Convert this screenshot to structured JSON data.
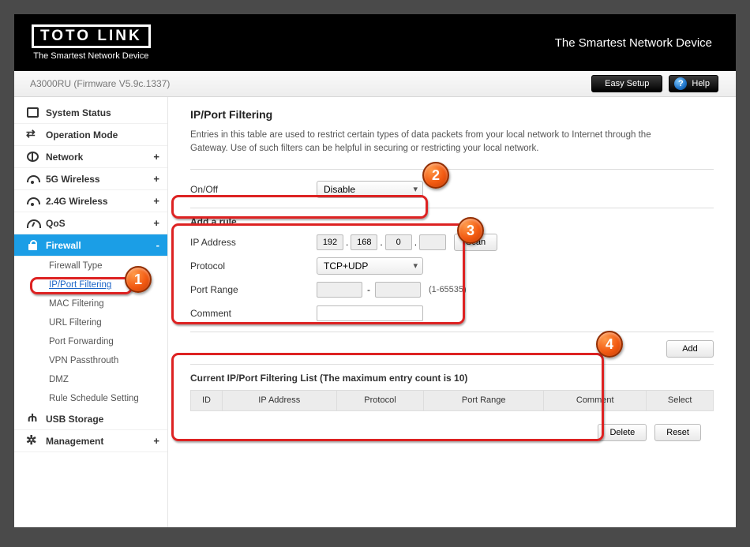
{
  "brand": {
    "logo": "TOTO LINK",
    "tagline": "The Smartest Network Device",
    "slogan": "The Smartest Network Device"
  },
  "firmware": "A3000RU (Firmware V5.9c.1337)",
  "topbuttons": {
    "easy": "Easy Setup",
    "help": "Help"
  },
  "sidebar": {
    "items": [
      {
        "label": "System Status"
      },
      {
        "label": "Operation Mode"
      },
      {
        "label": "Network",
        "expand": "+"
      },
      {
        "label": "5G Wireless",
        "expand": "+"
      },
      {
        "label": "2.4G Wireless",
        "expand": "+"
      },
      {
        "label": "QoS",
        "expand": "+"
      },
      {
        "label": "Firewall",
        "expand": "-"
      },
      {
        "label": "USB Storage"
      },
      {
        "label": "Management",
        "expand": "+"
      }
    ],
    "firewall_children": [
      "Firewall Type",
      "IP/Port Filtering",
      "MAC Filtering",
      "URL Filtering",
      "Port Forwarding",
      "VPN Passthrouth",
      "DMZ",
      "Rule Schedule Setting"
    ]
  },
  "page": {
    "title": "IP/Port Filtering",
    "desc": "Entries in this table are used to restrict certain types of data packets from your local network to Internet through the Gateway. Use of such filters can be helpful in securing or restricting your local network.",
    "onoff_label": "On/Off",
    "onoff_value": "Disable",
    "addrule_title": "Add a rule",
    "ip_label": "IP Address",
    "ip_parts": {
      "a": "192",
      "b": "168",
      "c": "0",
      "d": ""
    },
    "scan_btn": "Scan",
    "protocol_label": "Protocol",
    "protocol_value": "TCP+UDP",
    "portrange_label": "Port Range",
    "portrange_hint": "(1-65535)",
    "comment_label": "Comment",
    "add_btn": "Add",
    "list_title": "Current IP/Port Filtering List (The maximum entry count is 10)",
    "cols": {
      "id": "ID",
      "ip": "IP Address",
      "proto": "Protocol",
      "range": "Port Range",
      "comment": "Comment",
      "select": "Select"
    },
    "delete_btn": "Delete",
    "reset_btn": "Reset"
  },
  "callouts": {
    "c1": "1",
    "c2": "2",
    "c3": "3",
    "c4": "4"
  }
}
